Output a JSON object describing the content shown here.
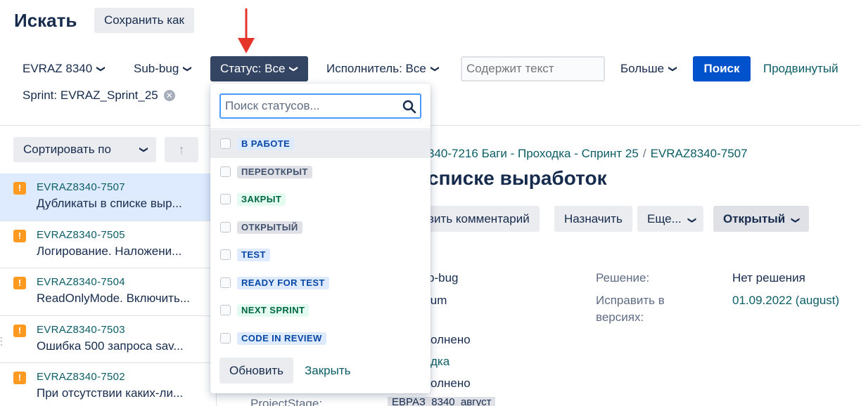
{
  "header": {
    "title": "Искать",
    "save_as": "Сохранить как"
  },
  "filters": {
    "project": "EVRAZ 8340",
    "type": "Sub-bug",
    "status": "Статус: Все",
    "assignee": "Исполнитель: Все",
    "text_placeholder": "Содержит текст",
    "more": "Больше",
    "search": "Поиск",
    "advanced": "Продвинутый",
    "sprint": "Sprint: EVRAZ_Sprint_25"
  },
  "sort": {
    "label": "Сортировать по",
    "direction": "↑"
  },
  "issues": [
    {
      "key": "EVRAZ8340-7507",
      "summary": "Дубликаты в списке выр..."
    },
    {
      "key": "EVRAZ8340-7505",
      "summary": "Логирование. Наложени..."
    },
    {
      "key": "EVRAZ8340-7504",
      "summary": "ReadOnlyMode. Включить..."
    },
    {
      "key": "EVRAZ8340-7503",
      "summary": "Ошибка 500 запроса sav..."
    },
    {
      "key": "EVRAZ8340-7502",
      "summary": "При отсутствии каких-ли..."
    }
  ],
  "detail": {
    "crumb_parent": "340-7216 Баги - Проходка - Спринт 25",
    "crumb_sep": "/",
    "crumb_current": "EVRAZ8340-7507",
    "title": "списке выработок",
    "actions": {
      "comment": "вить комментарий",
      "assign": "Назначить",
      "more": "Еще...",
      "status": "Открытый"
    },
    "fields": {
      "type_value": "b-bug",
      "priority_value": "ium",
      "resolution_label": "Решение:",
      "resolution_value": "Нет решения",
      "fix_version_label_1": "Исправить в",
      "fix_version_label_2": "версиях:",
      "fix_version_value": "01.09.2022 (august)",
      "row3": "олнено",
      "row4": "дка",
      "row5": "олнено",
      "project_stage_label": "ProjectStage:",
      "project_stage_value": "ЕВРАЗ_8340_август"
    }
  },
  "status_dropdown": {
    "search_placeholder": "Поиск статусов...",
    "options": [
      {
        "label": "В РАБОТЕ",
        "color": "blue"
      },
      {
        "label": "ПЕРЕОТКРЫТ",
        "color": "grey"
      },
      {
        "label": "ЗАКРЫТ",
        "color": "green"
      },
      {
        "label": "ОТКРЫТЫЙ",
        "color": "grey"
      },
      {
        "label": "TEST",
        "color": "blue"
      },
      {
        "label": "READY FOR TEST",
        "color": "blue"
      },
      {
        "label": "NEXT SPRINT",
        "color": "green"
      },
      {
        "label": "CODE IN REVIEW",
        "color": "blue"
      }
    ],
    "update": "Обновить",
    "close": "Закрыть"
  },
  "colors": {
    "primary": "#0052cc",
    "active_filter": "#344563",
    "link": "#0b5d66",
    "annotation_arrow": "#e5352b",
    "bug_icon": "#ff991f"
  }
}
